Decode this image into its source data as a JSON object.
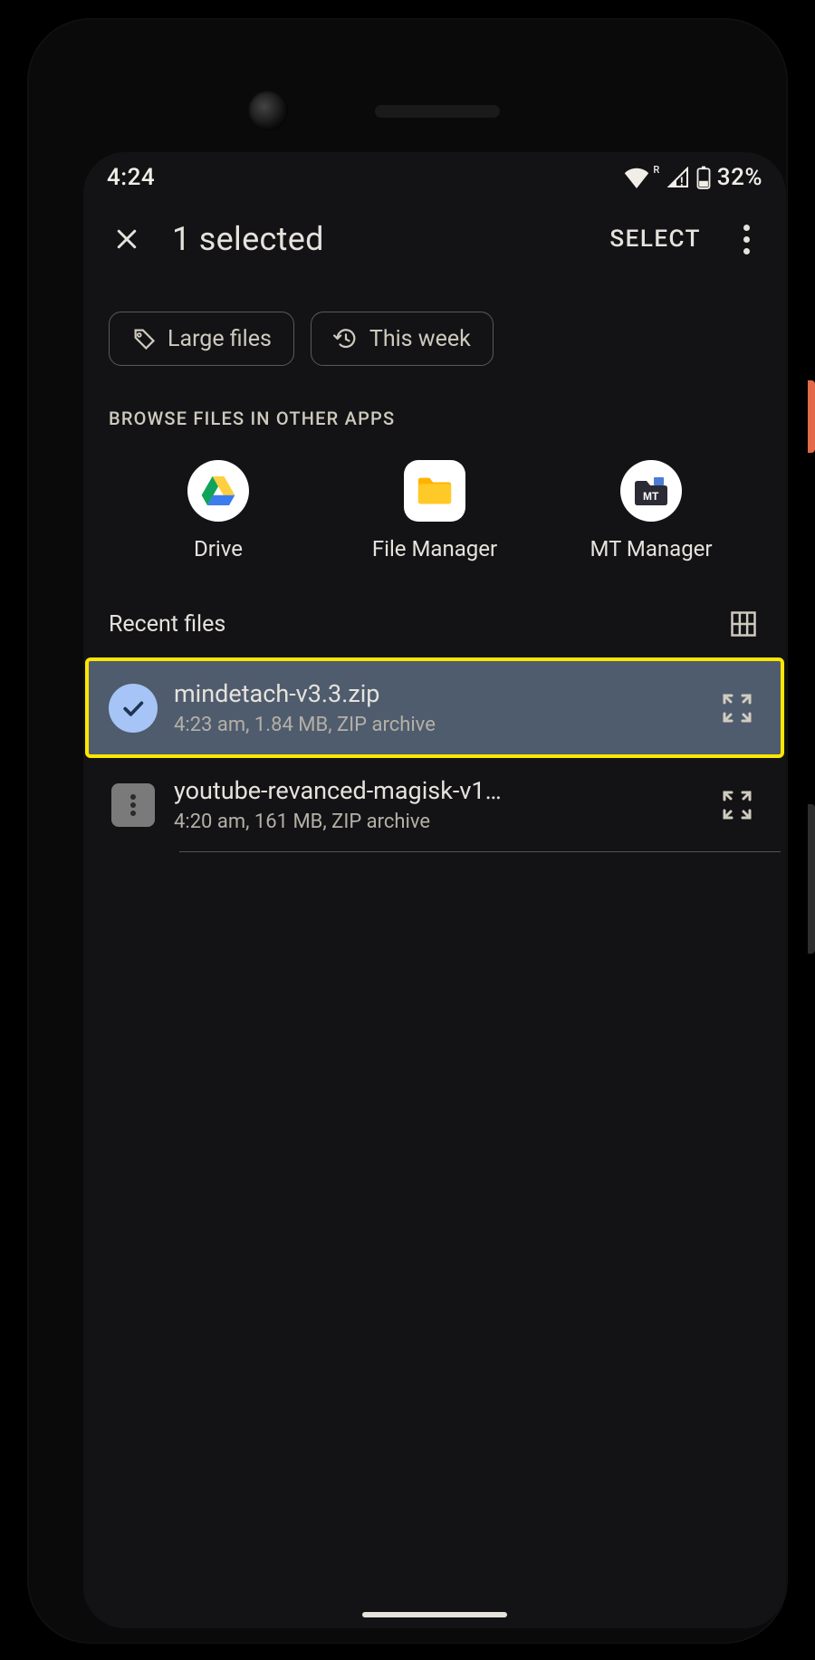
{
  "statusbar": {
    "time": "4:24",
    "battery": "32%",
    "roaming": "R"
  },
  "appbar": {
    "title": "1 selected",
    "select_label": "SELECT"
  },
  "chips": {
    "large": "Large files",
    "week": "This week"
  },
  "browse": {
    "label": "BROWSE FILES IN OTHER APPS",
    "apps": [
      {
        "name": "Drive"
      },
      {
        "name": "File Manager"
      },
      {
        "name": "MT Manager"
      }
    ]
  },
  "recent": {
    "title": "Recent files",
    "files": [
      {
        "name": "mindetach-v3.3.zip",
        "meta": "4:23 am, 1.84 MB, ZIP archive",
        "selected": true
      },
      {
        "name": "youtube-revanced-magisk-v1…",
        "meta": "4:20 am, 161 MB, ZIP archive",
        "selected": false
      }
    ]
  }
}
